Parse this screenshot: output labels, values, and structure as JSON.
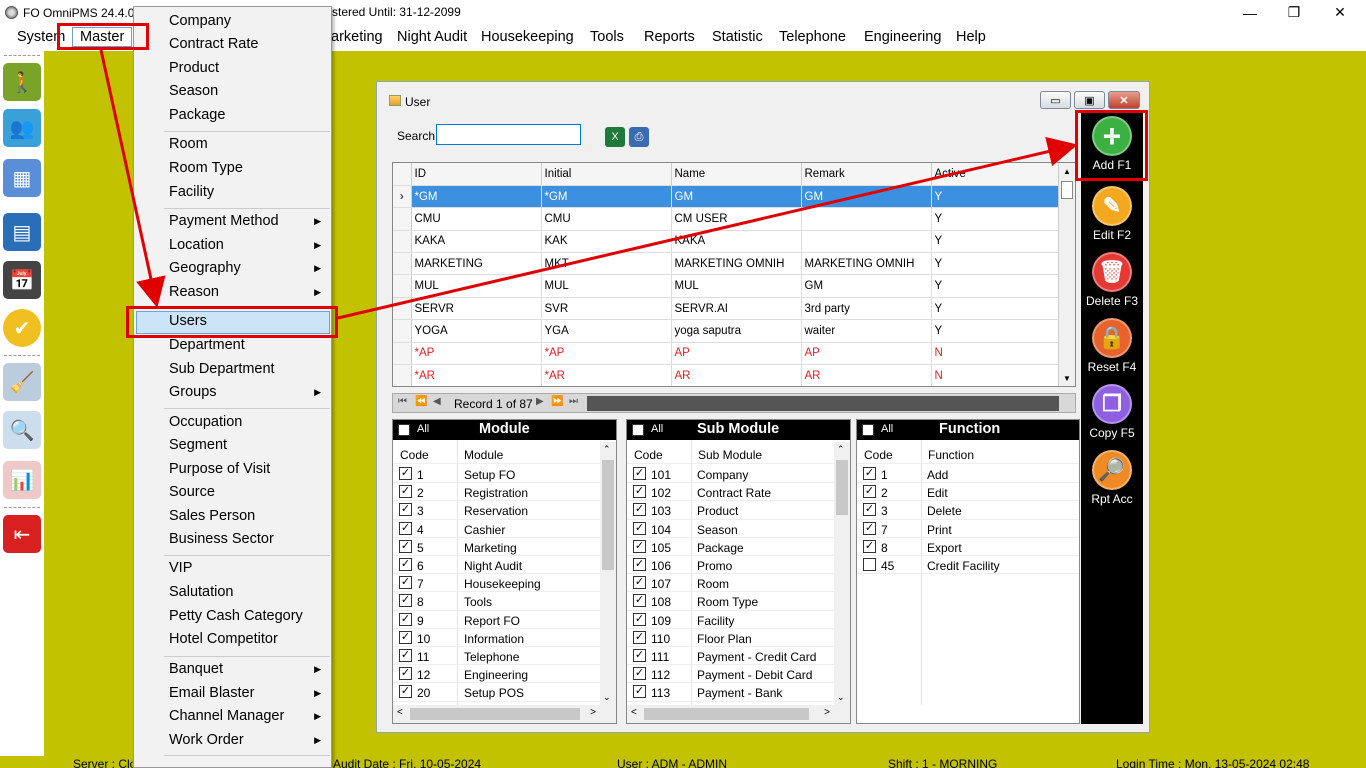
{
  "titlebar": {
    "app_title": "FO OmniPMS 24.4.0.",
    "registered": "stered Until: 31-12-2099",
    "minimize": "—",
    "restore": "❐",
    "close": "✕"
  },
  "menubar": {
    "items": [
      "System",
      "Master",
      "arketing",
      "Night Audit",
      "Housekeeping",
      "Tools",
      "Reports",
      "Statistic",
      "Telephone",
      "Engineering",
      "Help"
    ]
  },
  "dropdown": {
    "items": [
      "Company",
      "Contract Rate",
      "Product",
      "Season",
      "Package",
      "Room",
      "Room Type",
      "Facility",
      "Payment Method",
      "Location",
      "Geography",
      "Reason",
      "Users",
      "Department",
      "Sub Department",
      "Groups",
      "Occupation",
      "Segment",
      "Purpose of Visit",
      "Source",
      "Sales Person",
      "Business Sector",
      "VIP",
      "Salutation",
      "Petty Cash Category",
      "Hotel Competitor",
      "Banquet",
      "Email Blaster",
      "Channel Manager",
      "Work Order"
    ],
    "highlighted": "Users"
  },
  "statusbar": {
    "server": "Server : Clo",
    "audit_date": "Audit Date : Fri, 10-05-2024",
    "user": "User : ADM - ADMIN",
    "shift": "Shift : 1 - MORNING",
    "login_time": "Login Time : Mon, 13-05-2024 02:48"
  },
  "user_window": {
    "title": "User",
    "search_label": "Search",
    "search_value": "",
    "grid": {
      "columns": [
        "ID",
        "Initial",
        "Name",
        "Remark",
        "Active"
      ],
      "rows": [
        [
          "*GM",
          "*GM",
          "GM",
          "GM",
          "Y"
        ],
        [
          "CMU",
          "CMU",
          "CM USER",
          "",
          "Y"
        ],
        [
          "KAKA",
          "KAK",
          "KAKA",
          "",
          "Y"
        ],
        [
          "MARKETING",
          "MKT",
          "MARKETING OMNIH",
          "MARKETING OMNIH",
          "Y"
        ],
        [
          "MUL",
          "MUL",
          "MUL",
          "GM",
          "Y"
        ],
        [
          "SERVR",
          "SVR",
          "SERVR.AI",
          "3rd party",
          "Y"
        ],
        [
          "YOGA",
          "YGA",
          "yoga saputra",
          "waiter",
          "Y"
        ],
        [
          "*AP",
          "*AP",
          "AP",
          "AP",
          "N"
        ],
        [
          "*AR",
          "*AR",
          "AR",
          "AR",
          "N"
        ]
      ],
      "selected_row": 0,
      "record_text": "Record 1 of 87"
    },
    "module_panel": {
      "all_label": "All",
      "title": "Module",
      "col_code": "Code",
      "col_name": "Module",
      "rows": [
        [
          "1",
          "Setup FO"
        ],
        [
          "2",
          "Registration"
        ],
        [
          "3",
          "Reservation"
        ],
        [
          "4",
          "Cashier"
        ],
        [
          "5",
          "Marketing"
        ],
        [
          "6",
          "Night Audit"
        ],
        [
          "7",
          "Housekeeping"
        ],
        [
          "8",
          "Tools"
        ],
        [
          "9",
          "Report FO"
        ],
        [
          "10",
          "Information"
        ],
        [
          "11",
          "Telephone"
        ],
        [
          "12",
          "Engineering"
        ],
        [
          "20",
          "Setup POS"
        ]
      ]
    },
    "submodule_panel": {
      "all_label": "All",
      "title": "Sub Module",
      "col_code": "Code",
      "col_name": "Sub Module",
      "rows": [
        [
          "101",
          "Company"
        ],
        [
          "102",
          "Contract Rate"
        ],
        [
          "103",
          "Product"
        ],
        [
          "104",
          "Season"
        ],
        [
          "105",
          "Package"
        ],
        [
          "106",
          "Promo"
        ],
        [
          "107",
          "Room"
        ],
        [
          "108",
          "Room Type"
        ],
        [
          "109",
          "Facility"
        ],
        [
          "110",
          "Floor Plan"
        ],
        [
          "111",
          "Payment - Credit Card"
        ],
        [
          "112",
          "Payment - Debit Card"
        ],
        [
          "113",
          "Payment - Bank"
        ]
      ]
    },
    "function_panel": {
      "all_label": "All",
      "title": "Function",
      "col_code": "Code",
      "col_name": "Function",
      "rows": [
        [
          "1",
          "Add",
          true
        ],
        [
          "2",
          "Edit",
          true
        ],
        [
          "3",
          "Delete",
          true
        ],
        [
          "7",
          "Print",
          true
        ],
        [
          "8",
          "Export",
          true
        ],
        [
          "45",
          "Credit Facility",
          false
        ]
      ]
    },
    "actions": [
      {
        "label": "Add F1",
        "icon": "plus-icon",
        "color": "#3cb043"
      },
      {
        "label": "Edit F2",
        "icon": "edit-icon",
        "color": "#f4a820"
      },
      {
        "label": "Delete F3",
        "icon": "trash-icon",
        "color": "#e53935"
      },
      {
        "label": "Reset F4",
        "icon": "lock-icon",
        "color": "#e8632c"
      },
      {
        "label": "Copy F5",
        "icon": "copy-icon",
        "color": "#8e5fe0"
      },
      {
        "label": "Rpt Acc",
        "icon": "report-icon",
        "color": "#f08a24"
      }
    ]
  },
  "colors": {
    "desktop": "#c2c200",
    "selection": "#3c90e0",
    "annotation": "#e00000"
  }
}
